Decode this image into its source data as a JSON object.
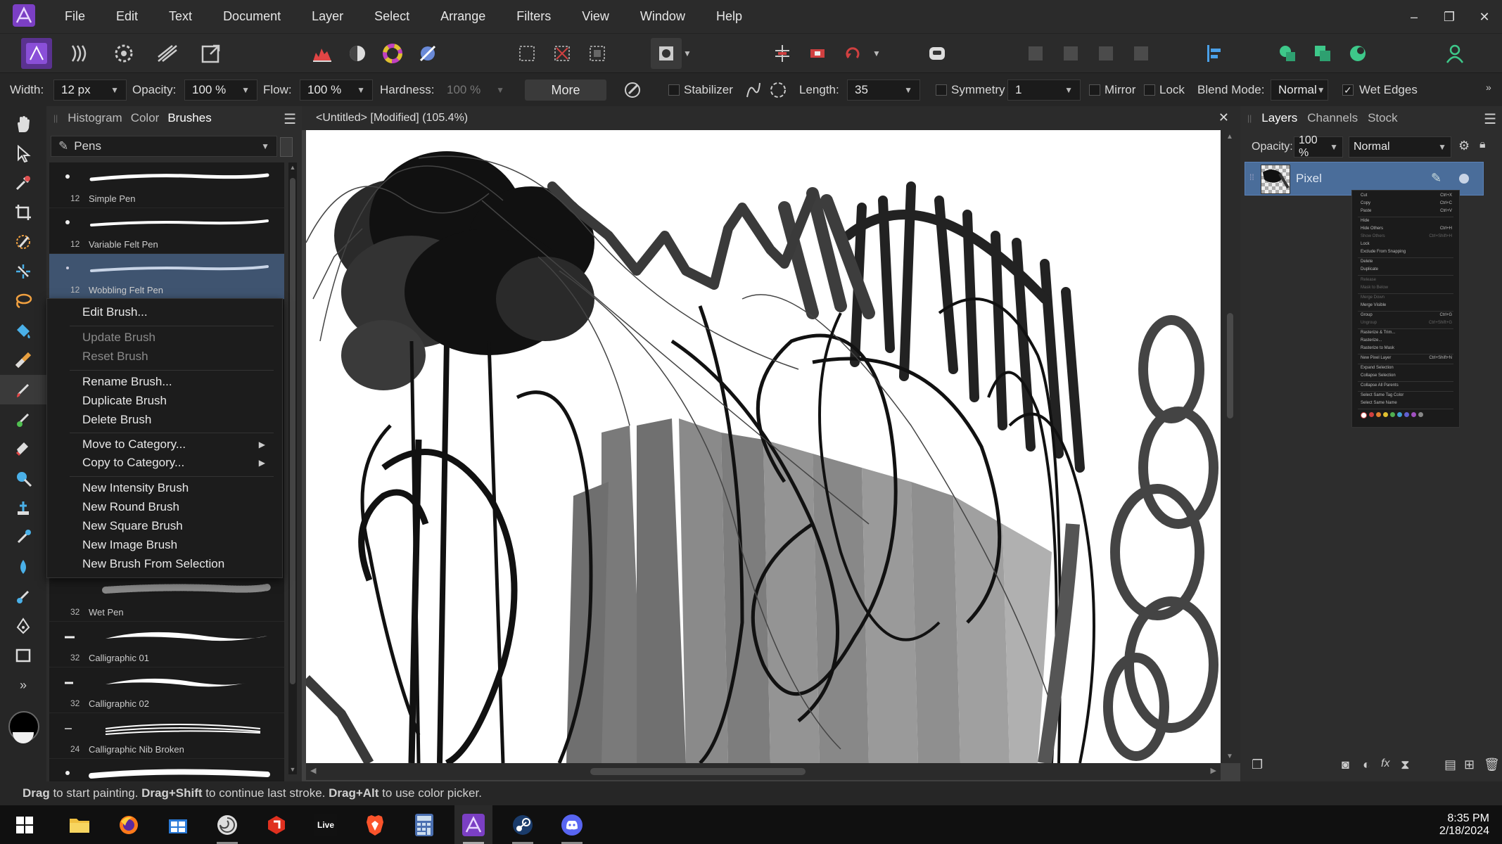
{
  "menubar": {
    "items": [
      "File",
      "Edit",
      "Text",
      "Document",
      "Layer",
      "Select",
      "Arrange",
      "Filters",
      "View",
      "Window",
      "Help"
    ]
  },
  "context_bar": {
    "width_label": "Width:",
    "width_value": "12 px",
    "opacity_label": "Opacity:",
    "opacity_value": "100 %",
    "flow_label": "Flow:",
    "flow_value": "100 %",
    "hardness_label": "Hardness:",
    "hardness_value": "100 %",
    "more_label": "More",
    "stabilizer_label": "Stabilizer",
    "length_label": "Length:",
    "length_value": "35",
    "symmetry_label": "Symmetry",
    "symmetry_value": "1",
    "mirror_label": "Mirror",
    "lock_label": "Lock",
    "blend_label": "Blend Mode:",
    "blend_value": "Normal",
    "wet_edges_label": "Wet Edges"
  },
  "brushes_panel": {
    "tabs": [
      "Histogram",
      "Color",
      "Brushes"
    ],
    "category": "Pens",
    "brushes": [
      {
        "size": "12",
        "name": "Simple Pen"
      },
      {
        "size": "12",
        "name": "Variable Felt Pen"
      },
      {
        "size": "12",
        "name": "Wobbling Felt Pen"
      },
      {
        "size": "32",
        "name": "Wet Pen"
      },
      {
        "size": "32",
        "name": "Calligraphic 01"
      },
      {
        "size": "32",
        "name": "Calligraphic 02"
      },
      {
        "size": "24",
        "name": "Calligraphic Nib Broken"
      }
    ]
  },
  "brush_context_menu": {
    "edit": "Edit Brush...",
    "update": "Update Brush",
    "reset": "Reset Brush",
    "rename": "Rename Brush...",
    "duplicate": "Duplicate Brush",
    "delete": "Delete Brush",
    "move": "Move to Category...",
    "copy": "Copy to Category...",
    "new_intensity": "New Intensity Brush",
    "new_round": "New Round Brush",
    "new_square": "New Square Brush",
    "new_image": "New Image Brush",
    "new_from_selection": "New Brush From Selection"
  },
  "document": {
    "tab_title": "<Untitled> [Modified] (105.4%)"
  },
  "layers_panel": {
    "tabs": [
      "Layers",
      "Channels",
      "Stock"
    ],
    "opacity_label": "Opacity:",
    "opacity_value": "100 %",
    "blend_value": "Normal",
    "layer_name": "Pixel"
  },
  "layer_menu": {
    "items": [
      {
        "label": "Cut",
        "shortcut": "Ctrl+X"
      },
      {
        "label": "Copy",
        "shortcut": "Ctrl+C"
      },
      {
        "label": "Paste",
        "shortcut": "Ctrl+V"
      },
      {
        "label": "Hide",
        "shortcut": ""
      },
      {
        "label": "Hide Others",
        "shortcut": "Ctrl+H"
      },
      {
        "label": "Show Others",
        "shortcut": "Ctrl+Shift+H"
      },
      {
        "label": "Lock",
        "shortcut": ""
      },
      {
        "label": "Exclude From Snapping",
        "shortcut": ""
      },
      {
        "label": "Delete",
        "shortcut": ""
      },
      {
        "label": "Duplicate",
        "shortcut": ""
      },
      {
        "label": "Release",
        "shortcut": ""
      },
      {
        "label": "Mask to Below",
        "shortcut": ""
      },
      {
        "label": "Merge Down",
        "shortcut": ""
      },
      {
        "label": "Merge Visible",
        "shortcut": ""
      },
      {
        "label": "Group",
        "shortcut": "Ctrl+G"
      },
      {
        "label": "Ungroup",
        "shortcut": "Ctrl+Shift+G"
      },
      {
        "label": "Rasterize & Trim...",
        "shortcut": ""
      },
      {
        "label": "Rasterize...",
        "shortcut": ""
      },
      {
        "label": "Rasterize to Mask",
        "shortcut": ""
      },
      {
        "label": "New Pixel Layer",
        "shortcut": "Ctrl+Shift+N"
      },
      {
        "label": "Expand Selection",
        "shortcut": ""
      },
      {
        "label": "Collapse Selection",
        "shortcut": ""
      },
      {
        "label": "Collapse All Parents",
        "shortcut": ""
      },
      {
        "label": "Select Same Tag Color",
        "shortcut": ""
      },
      {
        "label": "Select Same Name",
        "shortcut": ""
      }
    ]
  },
  "status": {
    "drag1": "Drag",
    "text1": " to start painting. ",
    "drag2": "Drag+Shift",
    "text2": " to continue last stroke. ",
    "drag3": "Drag+Alt",
    "text3": " to use color picker."
  },
  "taskbar": {
    "time": "8:35 PM",
    "date": "2/18/2024",
    "live_label": "Live"
  },
  "colors": {
    "accent": "#4a6d9a",
    "affinity_purple": "#7b3fc4",
    "panel_bg": "#2d2d2d"
  }
}
